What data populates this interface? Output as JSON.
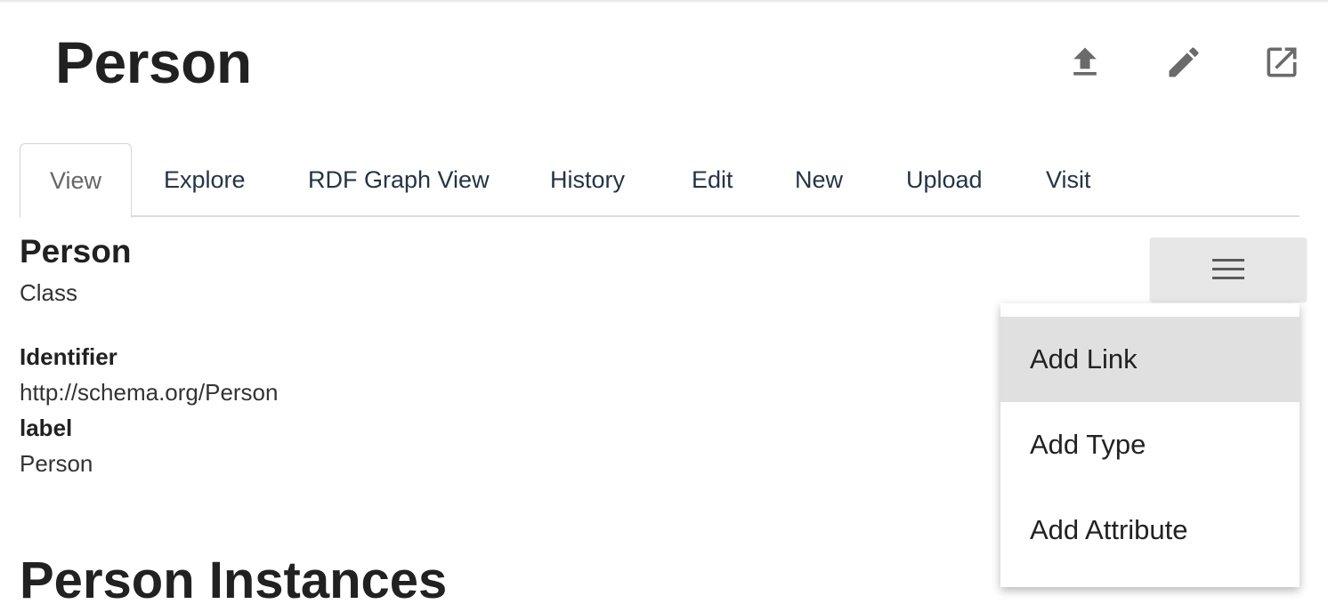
{
  "header": {
    "title": "Person",
    "icons": [
      "upload-icon",
      "pencil-icon",
      "open-in-new-icon"
    ],
    "icon_color": "#6b6b6b"
  },
  "tabs": [
    {
      "label": "View",
      "active": true
    },
    {
      "label": "Explore"
    },
    {
      "label": "RDF Graph View"
    },
    {
      "label": "History"
    },
    {
      "label": "Edit"
    },
    {
      "label": "New"
    },
    {
      "label": "Upload"
    },
    {
      "label": "Visit"
    }
  ],
  "resource": {
    "name": "Person",
    "type": "Class",
    "properties": [
      {
        "label": "Identifier",
        "value": "http://schema.org/Person"
      },
      {
        "label": "label",
        "value": "Person"
      }
    ]
  },
  "menu": {
    "button_icon": "hamburger-menu-icon",
    "items": [
      {
        "label": "Add Link",
        "highlighted": true
      },
      {
        "label": "Add Type"
      },
      {
        "label": "Add Attribute"
      }
    ]
  },
  "instances": {
    "title": "Person Instances"
  }
}
